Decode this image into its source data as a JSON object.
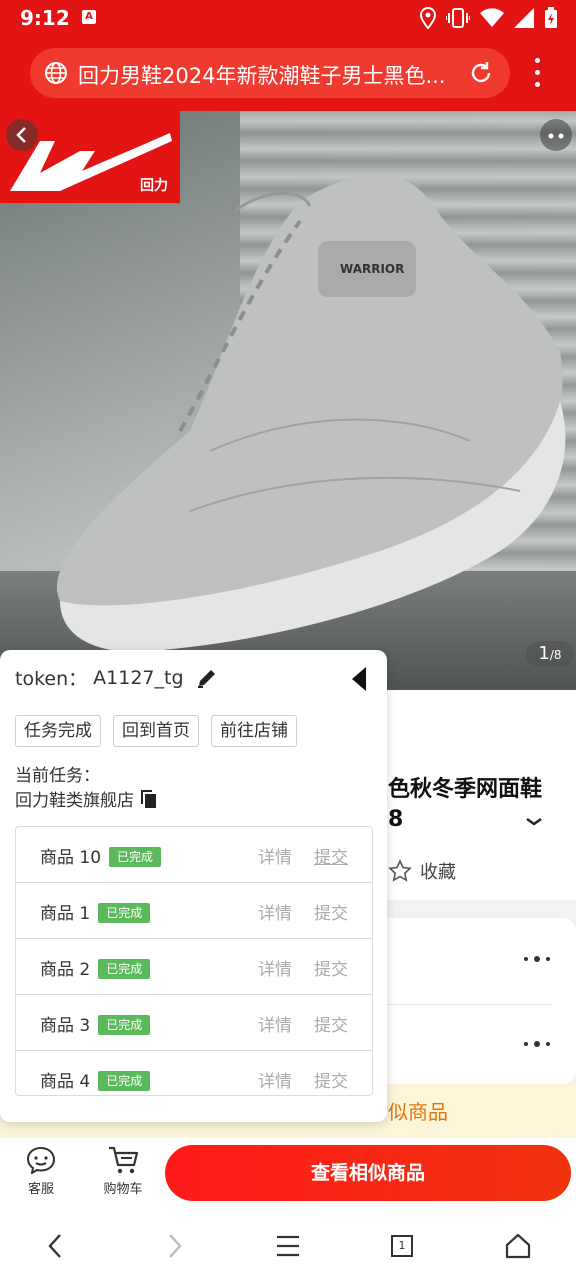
{
  "status_bar": {
    "time": "9:12",
    "app_badge": "A"
  },
  "browser": {
    "url_text": "回力男鞋2024年新款潮鞋子男士黑色..."
  },
  "hero": {
    "logo_text": "回力",
    "image_counter_current": "1",
    "image_counter_total": "/8"
  },
  "product": {
    "title_line1": "色秋冬季网面鞋",
    "title_line2": "8",
    "favorite_label": "收藏",
    "similar_banner": "似商品"
  },
  "panel": {
    "token_label": "token：",
    "token_value": "A1127_tg",
    "buttons": [
      "任务完成",
      "回到首页",
      "前往店铺"
    ],
    "current_task_label": "当前任务：",
    "current_task_value": "回力鞋类旗舰店",
    "rows": [
      {
        "name": "商品 10",
        "status": "已完成",
        "detail": "详情",
        "submit": "提交"
      },
      {
        "name": "商品 1",
        "status": "已完成",
        "detail": "详情",
        "submit": "提交"
      },
      {
        "name": "商品 2",
        "status": "已完成",
        "detail": "详情",
        "submit": "提交"
      },
      {
        "name": "商品 3",
        "status": "已完成",
        "detail": "详情",
        "submit": "提交"
      },
      {
        "name": "商品 4",
        "status": "已完成",
        "detail": "详情",
        "submit": "提交"
      }
    ]
  },
  "action_bar": {
    "service_label": "客服",
    "cart_label": "购物车",
    "similar_button": "查看相似商品"
  },
  "nav_bar": {
    "tabs_count": "1"
  },
  "colors": {
    "brand_red": "#e21414",
    "badge_green": "#5cb85c",
    "banner_orange": "#e4740f"
  },
  "icons": [
    "globe-icon",
    "reload-icon",
    "more-vert-icon",
    "back-arrow-icon",
    "more-dots-icon",
    "edit-icon",
    "collapse-icon",
    "copy-icon",
    "star-icon",
    "chevron-down-icon",
    "service-icon",
    "cart-icon",
    "nav-back-icon",
    "nav-forward-icon",
    "menu-icon",
    "tabs-icon",
    "home-icon"
  ]
}
